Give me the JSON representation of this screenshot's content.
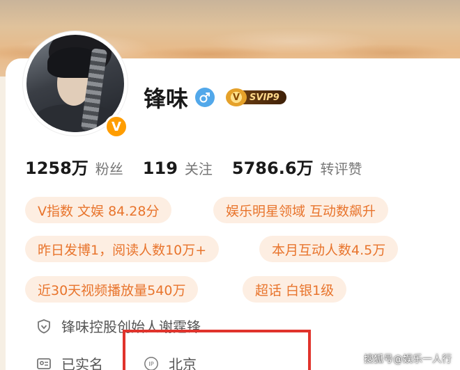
{
  "profile": {
    "name": "锋味",
    "vip_label": "SVIP9",
    "vip_crown_glyph": "V"
  },
  "stats": [
    {
      "value": "1258万",
      "label": "粉丝"
    },
    {
      "value": "119",
      "label": "关注"
    },
    {
      "value": "5786.6万",
      "label": "转评赞"
    }
  ],
  "tags": [
    "V指数 文娱 84.28分",
    "娱乐明星领域 互动数飙升",
    "昨日发博1，阅读人数10万+",
    "本月互动人数4.5万",
    "近30天视频播放量540万",
    "超话 白银1级"
  ],
  "info": {
    "company": "锋味控股创始人谢霆锋",
    "verified": "已实名",
    "ip_location": "北京"
  },
  "watermark": "搜狐号@娱乐一人行",
  "colors": {
    "tag_bg": "#fdeee2",
    "tag_text": "#e8742c",
    "verified_badge": "#ff9d00",
    "gender_male": "#52a8ea",
    "highlight_border": "#e0332c"
  },
  "icons": {
    "verified_badge": "v-badge-icon",
    "gender": "male-icon",
    "vip": "crown-icon",
    "company": "shield-icon",
    "verified": "id-card-icon",
    "ip": "ip-icon"
  }
}
